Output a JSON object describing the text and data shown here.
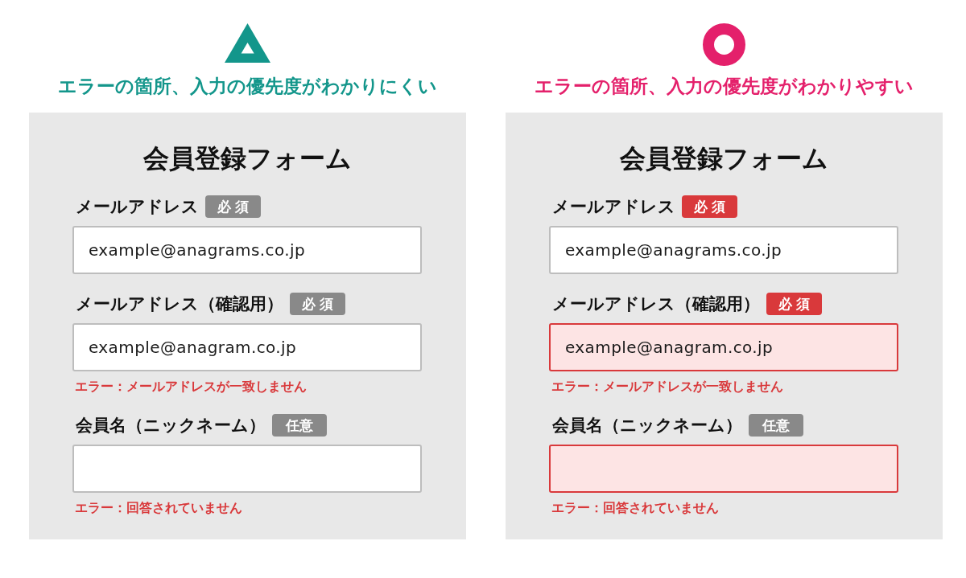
{
  "panels": [
    {
      "mark": {
        "kind": "triangle"
      },
      "color": "#13968b",
      "caption": "エラーの箇所、入力の優先度がわかりにくい",
      "form": {
        "title": "会員登録フォーム",
        "fields": [
          {
            "label": "メールアドレス",
            "badge": {
              "kind": "required",
              "text": "必須",
              "highlighted": false
            },
            "value": "example@anagrams.co.jp",
            "invalid": false
          },
          {
            "label": "メールアドレス（確認用）",
            "badge": {
              "kind": "required",
              "text": "必須",
              "highlighted": false
            },
            "value": "example@anagram.co.jp",
            "invalid": false,
            "error": "エラー：メールアドレスが一致しません"
          },
          {
            "label": "会員名（ニックネーム）",
            "badge": {
              "kind": "optional",
              "text": "任意",
              "highlighted": false
            },
            "invalid": false,
            "error": "エラー：回答されていません"
          }
        ]
      }
    },
    {
      "mark": {
        "kind": "circle"
      },
      "color": "#e4206b",
      "caption": "エラーの箇所、入力の優先度がわかりやすい",
      "form": {
        "title": "会員登録フォーム",
        "fields": [
          {
            "label": "メールアドレス",
            "badge": {
              "kind": "required",
              "text": "必須",
              "highlighted": true
            },
            "value": "example@anagrams.co.jp",
            "invalid": false
          },
          {
            "label": "メールアドレス（確認用）",
            "badge": {
              "kind": "required",
              "text": "必須",
              "highlighted": true
            },
            "value": "example@anagram.co.jp",
            "invalid": true,
            "error": "エラー：メールアドレスが一致しません"
          },
          {
            "label": "会員名（ニックネーム）",
            "badge": {
              "kind": "optional",
              "text": "任意",
              "highlighted": false
            },
            "invalid": true,
            "error": "エラー：回答されていません"
          }
        ]
      }
    }
  ]
}
